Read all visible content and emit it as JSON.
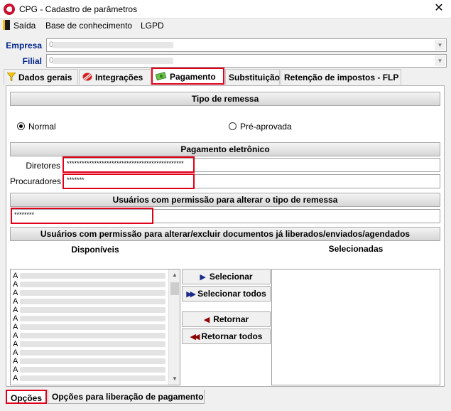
{
  "window": {
    "title": "CPG - Cadastro de parâmetros",
    "close_glyph": "✕",
    "app_icon": "cpg-logo-icon"
  },
  "menu": {
    "items": [
      "Saída",
      "Base de conhecimento",
      "LGPD"
    ]
  },
  "empresa": {
    "label": "Empresa",
    "value_first_char": "0"
  },
  "filial": {
    "label": "Filial",
    "value_first_char": "0"
  },
  "tabs": [
    {
      "label": "Dados gerais",
      "icon": "funnel-icon"
    },
    {
      "label": "Integrações",
      "icon": "stripes-icon"
    },
    {
      "label": "Pagamento",
      "icon": "money-icon",
      "active": true
    },
    {
      "label": "Substituição"
    },
    {
      "label": "Retenção de impostos - FLP"
    }
  ],
  "tipo_remessa": {
    "header": "Tipo de remessa",
    "options": [
      {
        "label": "Normal",
        "selected": true
      },
      {
        "label": "Pré-aprovada",
        "selected": false
      }
    ]
  },
  "pagamento_eletronico": {
    "header": "Pagamento eletrônico",
    "diretores_label": "Diretores",
    "diretores_value": "***********************************************",
    "procuradores_label": "Procuradores",
    "procuradores_value": "*******"
  },
  "usuarios_tipo_remessa": {
    "header": "Usuários com permissão para alterar o tipo de remessa",
    "value": "********"
  },
  "usuarios_documentos": {
    "header": "Usuários com permissão para alterar/excluir documentos já liberados/enviados/agendados",
    "disponiveis_label": "Disponíveis",
    "selecionadas_label": "Selecionadas",
    "disponiveis_items": [
      "A",
      "A",
      "A",
      "A",
      "A",
      "A",
      "A",
      "A",
      "A",
      "A",
      "A",
      "A",
      "A",
      "A"
    ],
    "buttons": {
      "selecionar": "Selecionar",
      "selecionar_todos": "Selecionar todos",
      "retornar": "Retornar",
      "retornar_todos": "Retornar todos"
    }
  },
  "bottom_tabs": [
    {
      "label": "Opções",
      "active": true
    },
    {
      "label": "Opções para liberação de pagamento"
    }
  ],
  "colors": {
    "highlight_red": "#e0001b",
    "label_blue": "#00258a",
    "arrow_navy": "#1a2a8a",
    "arrow_maroon": "#8b0000"
  }
}
